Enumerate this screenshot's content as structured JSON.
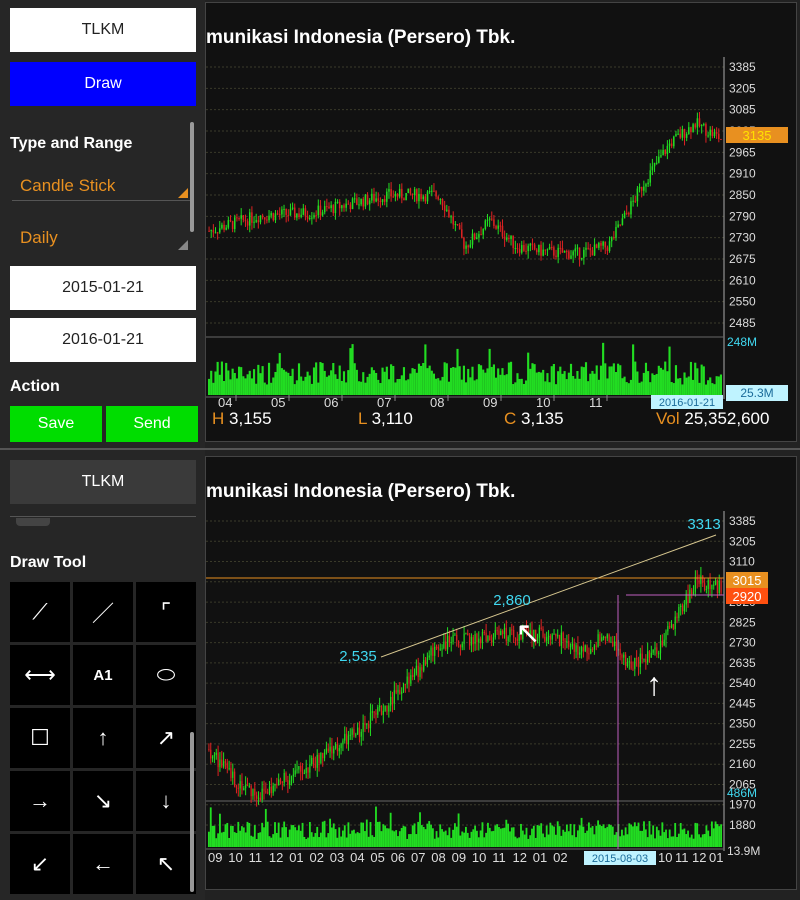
{
  "top_panel": {
    "symbol_button": "TLKM",
    "draw_button": "Draw",
    "type_range_label": "Type and Range",
    "chart_type": "Candle Stick",
    "period": "Daily",
    "start_date": "2015-01-21",
    "end_date": "2016-01-21",
    "action_label": "Action",
    "save_button": "Save",
    "send_button": "Send",
    "chart_title": "munikasi Indonesia (Persero) Tbk.",
    "y_ticks": [
      "3385",
      "3205",
      "3085",
      "3025",
      "2965",
      "2910",
      "2850",
      "2790",
      "2730",
      "2675",
      "2610",
      "2550",
      "2485"
    ],
    "price_marker": "3135",
    "volume_max": "248M",
    "volume_last": "25.3M",
    "x_ticks": [
      "04",
      "05",
      "06",
      "07",
      "08",
      "09",
      "10",
      "11"
    ],
    "date_marker": "2016-01-21",
    "ohlc": {
      "h_label": "H",
      "h_value": "3,155",
      "l_label": "L",
      "l_value": "3,110",
      "c_label": "C",
      "c_value": "3,135",
      "vol_label": "Vol",
      "vol_value": "25,352,600"
    }
  },
  "bottom_panel": {
    "symbol_button": "TLKM",
    "draw_tool_label": "Draw Tool",
    "tools": [
      {
        "icon": "line-diagonal-icon",
        "glyph": "⟋"
      },
      {
        "icon": "line-segment-icon",
        "glyph": "／"
      },
      {
        "icon": "corner-icon",
        "glyph": "⌜"
      },
      {
        "icon": "horizontal-line-icon",
        "glyph": "⟷"
      },
      {
        "icon": "text-tool-icon",
        "glyph": "A1"
      },
      {
        "icon": "ellipse-icon",
        "glyph": "⬭"
      },
      {
        "icon": "rectangle-icon",
        "glyph": "☐"
      },
      {
        "icon": "arrow-up-icon",
        "glyph": "↑"
      },
      {
        "icon": "arrow-up-right-icon",
        "glyph": "↗"
      },
      {
        "icon": "arrow-right-icon",
        "glyph": "→"
      },
      {
        "icon": "arrow-down-right-icon",
        "glyph": "↘"
      },
      {
        "icon": "arrow-down-icon",
        "glyph": "↓"
      },
      {
        "icon": "arrow-down-left-icon",
        "glyph": "↙"
      },
      {
        "icon": "arrow-left-icon",
        "glyph": "←"
      },
      {
        "icon": "arrow-up-left-icon",
        "glyph": "↖"
      }
    ],
    "chart_title": "munikasi Indonesia (Persero) Tbk.",
    "y_ticks": [
      "3385",
      "3205",
      "3110",
      "3015",
      "2920",
      "2825",
      "2730",
      "2635",
      "2540",
      "2445",
      "2350",
      "2255",
      "2160",
      "2065",
      "1970",
      "1880"
    ],
    "price_marker_high": "3015",
    "price_marker_low": "2920",
    "annotations": [
      "3313",
      "2,860",
      "2,535"
    ],
    "volume_max": "486M",
    "volume_last": "13.9M",
    "x_ticks": [
      "09",
      "10",
      "11",
      "12",
      "01",
      "02",
      "03",
      "04",
      "05",
      "06",
      "07",
      "08",
      "09",
      "10",
      "11",
      "12",
      "01",
      "02",
      "03",
      "04",
      "05"
    ],
    "x_ticks_tail": [
      "10",
      "11",
      "12",
      "01"
    ],
    "date_marker": "2015-08-03"
  },
  "colors": {
    "up": "#22dd22",
    "down": "#dd2222",
    "accent_orange": "#e89020",
    "accent_cyan": "#40d8f0",
    "blue_button": "#0000ff",
    "green_button": "#00dd00"
  }
}
